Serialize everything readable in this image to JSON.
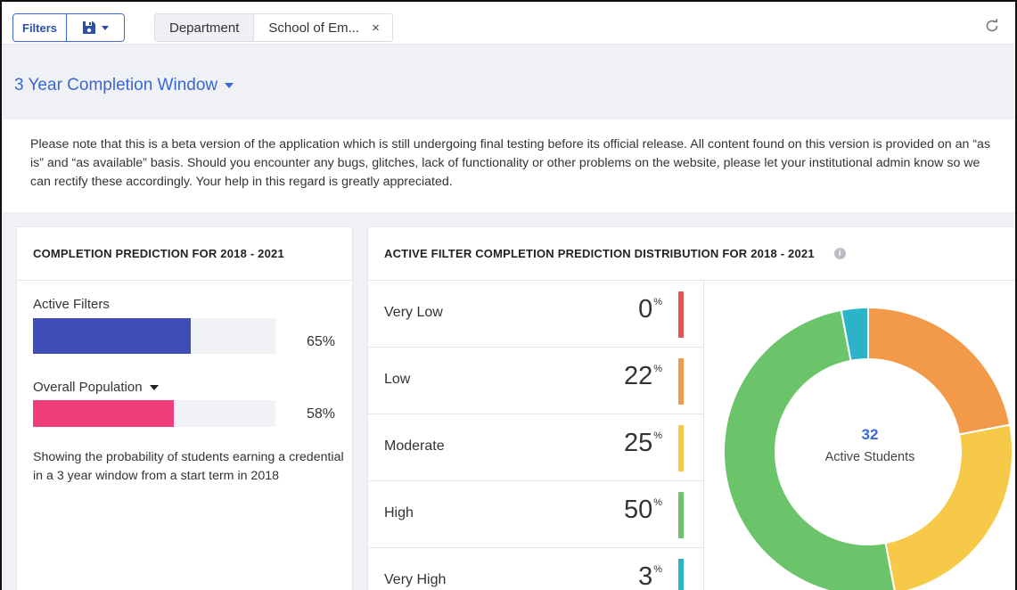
{
  "toolbar": {
    "filters_label": "Filters",
    "chip_key": "Department",
    "chip_value": "School of Em...",
    "chip_close": "×"
  },
  "window": {
    "title": "3 Year Completion Window"
  },
  "notice": {
    "text": "Please note that this is a beta version of the application which is still undergoing final testing before its official release. All content found on this version is provided on an “as is” and “as available” basis. Should you encounter any bugs, glitches, lack of functionality or other problems on the website, please let your institutional admin know so we can rectify these accordingly. Your help in this regard is greatly appreciated."
  },
  "left_card": {
    "title": "COMPLETION PREDICTION FOR 2018 - 2021",
    "active": {
      "label": "Active Filters",
      "value": 65,
      "value_text": "65%",
      "color": "#3f4db8"
    },
    "overall": {
      "label": "Overall Population",
      "value": 58,
      "value_text": "58%",
      "color": "#f03e7a"
    },
    "description": "Showing the probability of students earning a credential in a 3 year window from a start term in 2018"
  },
  "right_card": {
    "title": "ACTIVE FILTER COMPLETION PREDICTION DISTRIBUTION FOR 2018 - 2021",
    "pct_suffix": "%",
    "rows": [
      {
        "label": "Very Low",
        "value": "0",
        "color": "#e55353"
      },
      {
        "label": "Low",
        "value": "22",
        "color": "#f2994a"
      },
      {
        "label": "Moderate",
        "value": "25",
        "color": "#f7c948"
      },
      {
        "label": "High",
        "value": "50",
        "color": "#6cc46a"
      },
      {
        "label": "Very High",
        "value": "3",
        "color": "#2bb3c8"
      }
    ],
    "donut": {
      "count": "32",
      "label": "Active Students"
    }
  },
  "colors": {
    "accent": "#3a66d6"
  }
}
